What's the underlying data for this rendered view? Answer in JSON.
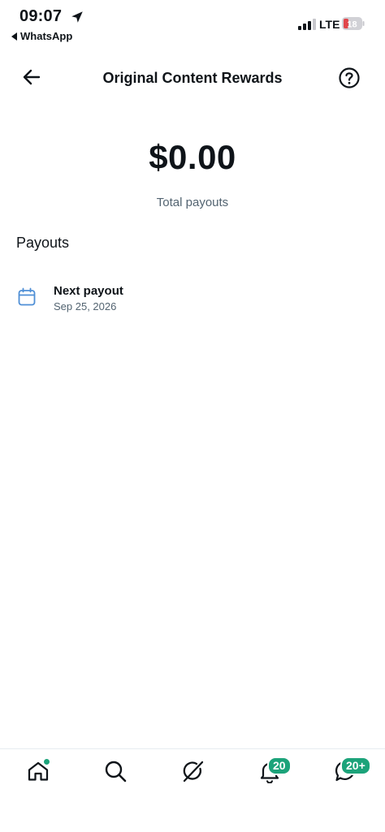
{
  "status_bar": {
    "time": "09:07",
    "back_app": "WhatsApp",
    "network": "LTE",
    "battery_level": "18",
    "battery_color": "#e0474c"
  },
  "header": {
    "title": "Original Content Rewards",
    "back_icon": "arrow-left-icon",
    "help_icon": "question-circle-icon"
  },
  "balance": {
    "amount": "$0.00",
    "label": "Total payouts"
  },
  "payouts": {
    "section_title": "Payouts",
    "items": [
      {
        "title": "Next payout",
        "date": "Sep 25, 2026",
        "icon": "calendar-icon"
      }
    ]
  },
  "bottom_nav": {
    "accent": "#1ca37a",
    "items": [
      {
        "name": "home",
        "icon": "home-icon",
        "badge": ""
      },
      {
        "name": "search",
        "icon": "search-icon",
        "badge": ""
      },
      {
        "name": "grok",
        "icon": "grok-icon",
        "badge": ""
      },
      {
        "name": "notifications",
        "icon": "bell-icon",
        "badge": "20"
      },
      {
        "name": "messages",
        "icon": "message-icon",
        "badge": "20+"
      }
    ]
  }
}
